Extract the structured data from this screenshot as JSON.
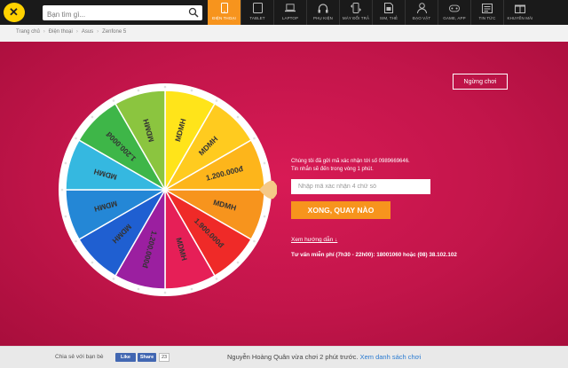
{
  "search": {
    "placeholder": "Bạn tìm gì..."
  },
  "nav": [
    {
      "label": "ĐIỆN THOẠI",
      "icon": "phone-icon",
      "active": true
    },
    {
      "label": "TABLET",
      "icon": "tablet-icon"
    },
    {
      "label": "LAPTOP",
      "icon": "laptop-icon"
    },
    {
      "label": "PHỤ KIỆN",
      "icon": "headphones-icon"
    },
    {
      "label": "MÁY ĐỔI TRẢ",
      "icon": "swap-phone-icon"
    },
    {
      "label": "SIM, THẺ",
      "icon": "sim-card-icon"
    },
    {
      "label": "ĐẠO VẬT",
      "icon": "person-icon"
    },
    {
      "label": "GAME, APP",
      "icon": "gamepad-icon"
    },
    {
      "label": "TIN TỨC",
      "icon": "news-icon"
    },
    {
      "label": "KHUYẾN MÃI",
      "icon": "gift-icon"
    }
  ],
  "breadcrumb": [
    "Trang chủ",
    "Điện thoại",
    "Asus",
    "Zenfone 5"
  ],
  "game": {
    "stop_label": "Ngừng chơi",
    "info_line1": "Chúng tôi đã gửi mã xác nhận tới số 0989669646.",
    "info_line2": "Tin nhắn sẽ đến trong vòng 1 phút.",
    "code_placeholder": "Nhập mã xác nhận 4 chữ số",
    "go_label": "XONG, QUAY NÀO",
    "guide_label": "Xem hướng dẫn ↓",
    "hotline": "Tư vấn miễn phí (7h30 - 22h00): 18001060 hoặc (08) 38.102.102"
  },
  "wheel": {
    "segments": [
      {
        "label": "MDMH",
        "color": "#ffe41a"
      },
      {
        "label": "MDMH",
        "color": "#ffcb1f"
      },
      {
        "label": "1.200.000đ",
        "color": "#fdb51b"
      },
      {
        "label": "MDMH",
        "color": "#f7941d"
      },
      {
        "label": "1.900.000đ",
        "color": "#ef2a28"
      },
      {
        "label": "MDMH",
        "color": "#e61f57"
      },
      {
        "label": "1.200.000đ",
        "color": "#9b1fa0"
      },
      {
        "label": "MDMH",
        "color": "#1f5fd1"
      },
      {
        "label": "MDMH",
        "color": "#2487d6"
      },
      {
        "label": "MDMH",
        "color": "#35b8e0"
      },
      {
        "label": "1.200.000đ",
        "color": "#3eb648"
      },
      {
        "label": "MDMH",
        "color": "#8bc53f"
      }
    ]
  },
  "footer": {
    "share_label": "Chia sẻ với bạn bè",
    "like_label": "Like",
    "share_btn": "Share",
    "share_count": "23",
    "ticker_text": "Nguyễn Hoàng Quân vừa chơi 2 phút trước.",
    "ticker_link": "Xem danh sách chơi"
  }
}
